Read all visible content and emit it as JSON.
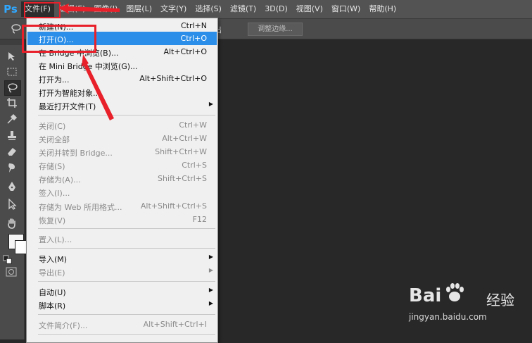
{
  "app": {
    "logo": "Ps",
    "accent_color": "#31a8ff"
  },
  "menubar": {
    "items": [
      "文件(F)",
      "编辑(E)",
      "图像(I)",
      "图层(L)",
      "文字(Y)",
      "选择(S)",
      "滤镜(T)",
      "3D(D)",
      "视图(V)",
      "窗口(W)",
      "帮助(H)"
    ],
    "active_index": 0
  },
  "optionsbar": {
    "partial_label": "出",
    "refine_edge_button": "调整边缘..."
  },
  "file_menu": {
    "items": [
      {
        "label": "新建(N)...",
        "shortcut": "Ctrl+N"
      },
      {
        "label": "打开(O)...",
        "shortcut": "Ctrl+O",
        "highlighted": true
      },
      {
        "label": "在 Bridge 中浏览(B)...",
        "shortcut": "Alt+Ctrl+O"
      },
      {
        "label": "在 Mini Bridge 中浏览(G)...",
        "shortcut": ""
      },
      {
        "label": "打开为...",
        "shortcut": "Alt+Shift+Ctrl+O"
      },
      {
        "label": "打开为智能对象...",
        "shortcut": ""
      },
      {
        "label": "最近打开文件(T)",
        "shortcut": "",
        "submenu": true
      },
      {
        "label": "关闭(C)",
        "shortcut": "Ctrl+W",
        "disabled": true
      },
      {
        "label": "关闭全部",
        "shortcut": "Alt+Ctrl+W",
        "disabled": true
      },
      {
        "label": "关闭并转到 Bridge...",
        "shortcut": "Shift+Ctrl+W",
        "disabled": true
      },
      {
        "label": "存储(S)",
        "shortcut": "Ctrl+S",
        "disabled": true
      },
      {
        "label": "存储为(A)...",
        "shortcut": "Shift+Ctrl+S",
        "disabled": true
      },
      {
        "label": "签入(I)...",
        "shortcut": "",
        "disabled": true
      },
      {
        "label": "存储为 Web 所用格式...",
        "shortcut": "Alt+Shift+Ctrl+S",
        "disabled": true
      },
      {
        "label": "恢复(V)",
        "shortcut": "F12",
        "disabled": true
      },
      {
        "label": "置入(L)...",
        "shortcut": "",
        "disabled": true
      },
      {
        "label": "导入(M)",
        "shortcut": "",
        "submenu": true
      },
      {
        "label": "导出(E)",
        "shortcut": "",
        "submenu": true,
        "disabled": true
      },
      {
        "label": "自动(U)",
        "shortcut": "",
        "submenu": true
      },
      {
        "label": "脚本(R)",
        "shortcut": "",
        "submenu": true
      },
      {
        "label": "文件简介(F)...",
        "shortcut": "Alt+Shift+Ctrl+I",
        "disabled": true
      }
    ],
    "highlight_color": "#2b8ee8"
  },
  "annotations": {
    "color": "#e8202a"
  },
  "watermark": {
    "brand": "Bai",
    "brand_cn": "经验",
    "url": "jingyan.baidu.com"
  }
}
